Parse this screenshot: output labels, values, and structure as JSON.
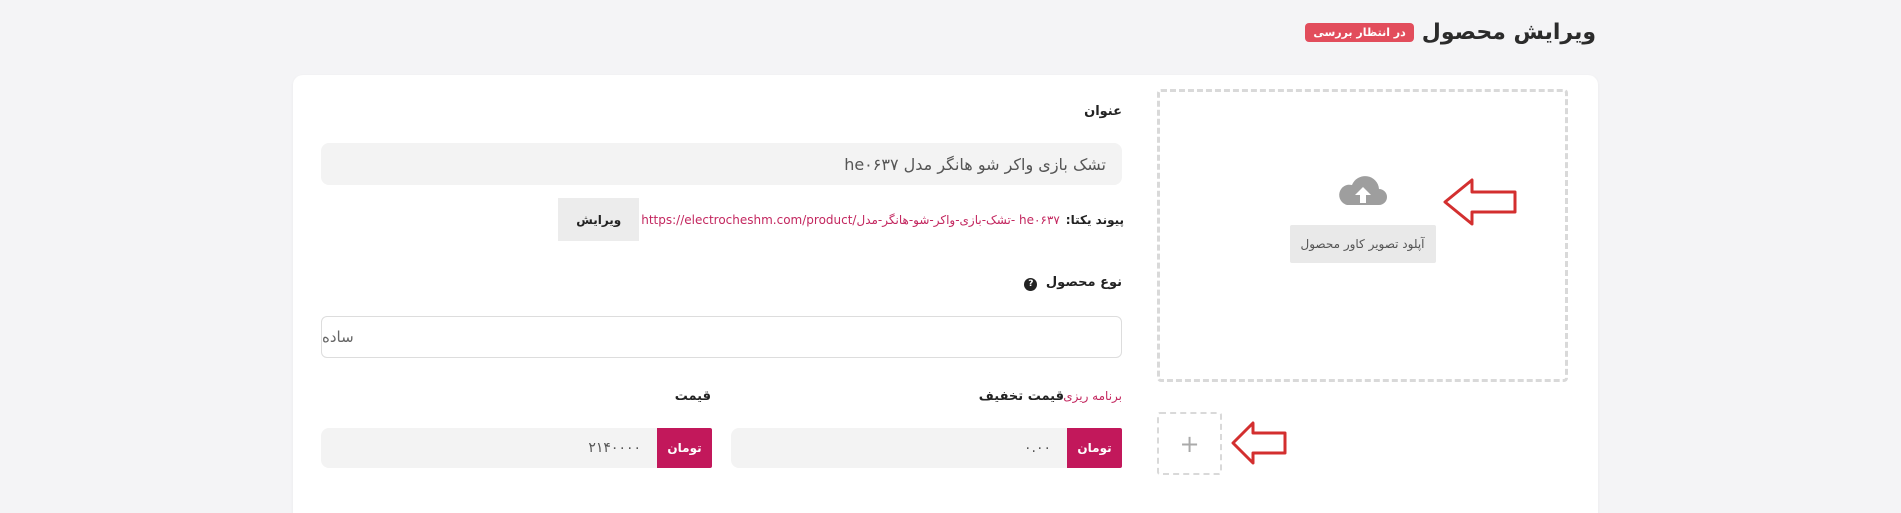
{
  "header": {
    "title": "ویرایش محصول",
    "status_badge": "در انتظار بررسی"
  },
  "cover": {
    "upload_label": "آپلود تصویر کاور محصول",
    "icon": "cloud-upload-icon",
    "gallery_add_label": "+"
  },
  "form": {
    "title_label": "عنوان",
    "title_value": "تشک بازی واکر شو هانگر مدل he۰۶۳۷",
    "permalink_label": "پیوند یکتا:",
    "permalink_url": "https://electrocheshm.com/product/تشک-بازی-واکر-شو-هانگر-مدل- he۰۶۳۷",
    "permalink_edit": "ویرایش",
    "product_type_label": "نوع محصول",
    "product_type_help": "?",
    "product_type_value": "ساده",
    "sale_price_label": "قیمت تخفیف",
    "schedule_link": "برنامه ریزی",
    "sale_price_value": "۰.۰۰",
    "price_label": "قیمت",
    "price_value": "۲۱۴۰۰۰۰",
    "currency": "تومان"
  },
  "colors": {
    "accent": "#c2185b",
    "badge": "#e24d5c",
    "arrow": "#d32f2f"
  }
}
